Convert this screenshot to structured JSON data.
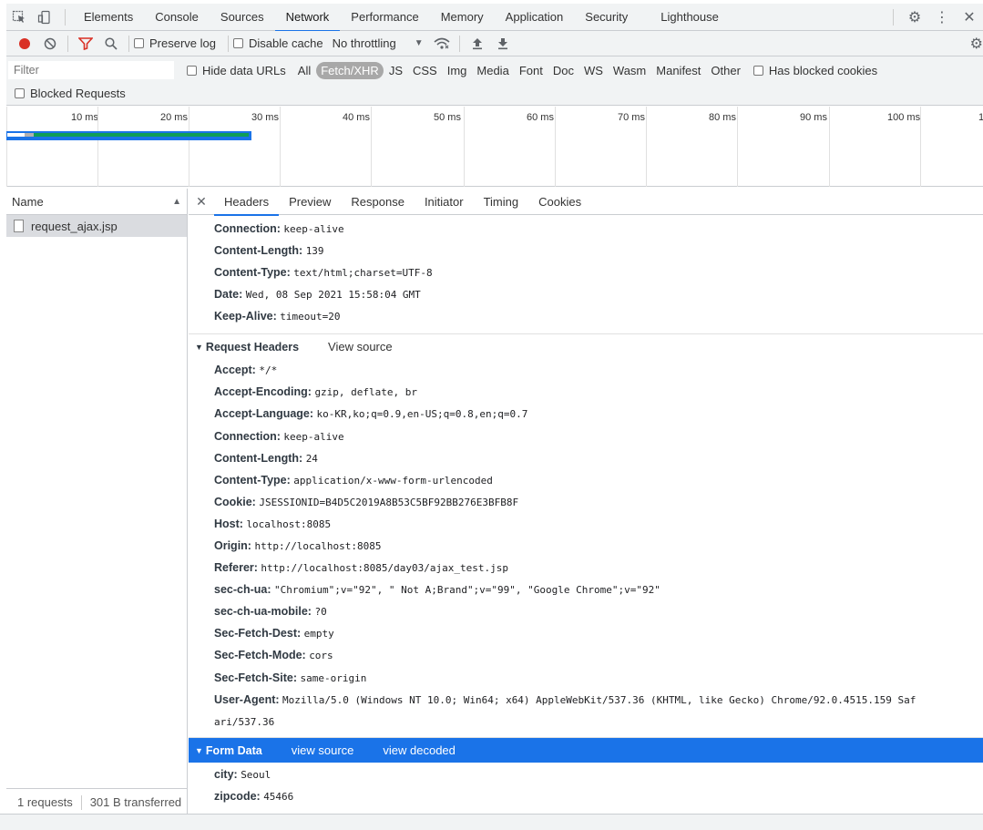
{
  "devtools": {
    "tabs": [
      "Elements",
      "Console",
      "Sources",
      "Network",
      "Performance",
      "Memory",
      "Application",
      "Security",
      "Lighthouse"
    ],
    "active_tab": "Network"
  },
  "toolbar": {
    "preserve_log": "Preserve log",
    "disable_cache": "Disable cache",
    "throttling": "No throttling"
  },
  "filter": {
    "placeholder": "Filter",
    "hide_data_urls": "Hide data URLs",
    "types": [
      "All",
      "Fetch/XHR",
      "JS",
      "CSS",
      "Img",
      "Media",
      "Font",
      "Doc",
      "WS",
      "Wasm",
      "Manifest",
      "Other"
    ],
    "active_type": "Fetch/XHR",
    "has_blocked_cookies": "Has blocked cookies",
    "blocked_requests": "Blocked Requests"
  },
  "timeline": {
    "ticks": [
      "10 ms",
      "20 ms",
      "30 ms",
      "40 ms",
      "50 ms",
      "60 ms",
      "70 ms",
      "80 ms",
      "90 ms",
      "100 ms",
      "1"
    ]
  },
  "requests": {
    "column_name": "Name",
    "items": [
      "request_ajax.jsp"
    ],
    "count_text": "1 requests",
    "transferred_text": "301 B transferred"
  },
  "detail": {
    "tabs": [
      "Headers",
      "Preview",
      "Response",
      "Initiator",
      "Timing",
      "Cookies"
    ],
    "active_tab": "Headers",
    "response_headers": [
      {
        "name": "Connection:",
        "value": "keep-alive"
      },
      {
        "name": "Content-Length:",
        "value": "139"
      },
      {
        "name": "Content-Type:",
        "value": "text/html;charset=UTF-8"
      },
      {
        "name": "Date:",
        "value": "Wed, 08 Sep 2021 15:58:04 GMT"
      },
      {
        "name": "Keep-Alive:",
        "value": "timeout=20"
      }
    ],
    "request_section": {
      "title": "Request Headers",
      "link": "View source"
    },
    "request_headers": [
      {
        "name": "Accept:",
        "value": "*/*"
      },
      {
        "name": "Accept-Encoding:",
        "value": "gzip, deflate, br"
      },
      {
        "name": "Accept-Language:",
        "value": "ko-KR,ko;q=0.9,en-US;q=0.8,en;q=0.7"
      },
      {
        "name": "Connection:",
        "value": "keep-alive"
      },
      {
        "name": "Content-Length:",
        "value": "24"
      },
      {
        "name": "Content-Type:",
        "value": "application/x-www-form-urlencoded"
      },
      {
        "name": "Cookie:",
        "value": "JSESSIONID=B4D5C2019A8B53C5BF92BB276E3BFB8F"
      },
      {
        "name": "Host:",
        "value": "localhost:8085"
      },
      {
        "name": "Origin:",
        "value": "http://localhost:8085"
      },
      {
        "name": "Referer:",
        "value": "http://localhost:8085/day03/ajax_test.jsp"
      },
      {
        "name": "sec-ch-ua:",
        "value": "\"Chromium\";v=\"92\", \" Not A;Brand\";v=\"99\", \"Google Chrome\";v=\"92\""
      },
      {
        "name": "sec-ch-ua-mobile:",
        "value": "?0"
      },
      {
        "name": "Sec-Fetch-Dest:",
        "value": "empty"
      },
      {
        "name": "Sec-Fetch-Mode:",
        "value": "cors"
      },
      {
        "name": "Sec-Fetch-Site:",
        "value": "same-origin"
      },
      {
        "name": "User-Agent:",
        "value": "Mozilla/5.0 (Windows NT 10.0; Win64; x64) AppleWebKit/537.36 (KHTML, like Gecko) Chrome/92.0.4515.159 Saf"
      }
    ],
    "user_agent_cont": "ari/537.36",
    "form_section": {
      "title": "Form Data",
      "link1": "view source",
      "link2": "view decoded"
    },
    "form_data": [
      {
        "name": "city:",
        "value": "Seoul"
      },
      {
        "name": "zipcode:",
        "value": "45466"
      }
    ]
  }
}
